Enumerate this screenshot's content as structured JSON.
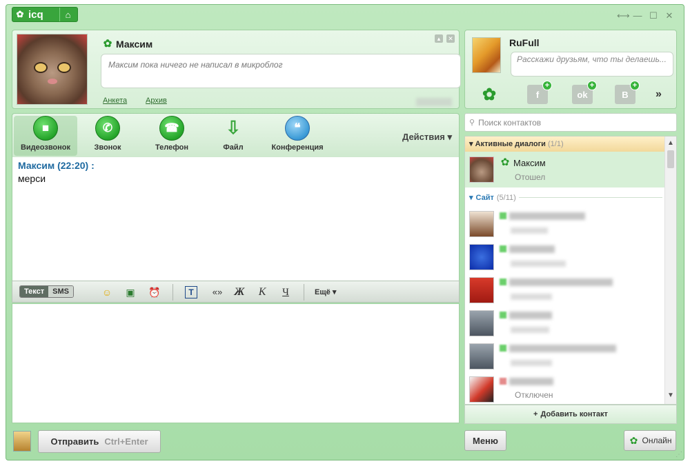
{
  "titlebar": {
    "logo_text": "icq",
    "logo_icon": "icq-flower-icon",
    "home_icon": "home-icon",
    "controls": [
      "⟷",
      "—",
      "☐",
      "✕"
    ]
  },
  "conversation": {
    "contact_name": "Максим",
    "microblog": "Максим пока ничего не написал в микроблог",
    "links": {
      "profile": "Анкета",
      "archive": "Архив"
    }
  },
  "toolbar": {
    "video": "Видеозвонок",
    "call": "Звонок",
    "phone": "Телефон",
    "file": "Файл",
    "conference": "Конференция",
    "actions": "Действия"
  },
  "chat": {
    "messages": [
      {
        "header": "Максим (22:20) :",
        "text": "мерси"
      }
    ]
  },
  "format_bar": {
    "mode_text": "Текст",
    "mode_sms": "SMS",
    "quote": "«»",
    "bold": "Ж",
    "italic": "К",
    "underline": "Ч",
    "more": "Ещё"
  },
  "send": {
    "label": "Отправить",
    "hotkey": "Ctrl+Enter"
  },
  "self": {
    "name": "RuFull",
    "status_placeholder": "Расскажи друзьям, что ты делаешь..."
  },
  "services": {
    "fb": "f",
    "ok": "ok",
    "vk": "B",
    "more": "»"
  },
  "search": {
    "placeholder": "Поиск контактов"
  },
  "contact_list": {
    "active_group": {
      "label": "Активные диалоги",
      "count": "(1/1)"
    },
    "active_contact": {
      "name": "Максим",
      "status": "Отошел"
    },
    "site_group": {
      "label": "Сайт",
      "count": "(5/11)"
    },
    "last_status": "Отключен"
  },
  "footer": {
    "add_contact": "Добавить контакт",
    "menu": "Меню",
    "status": "Онлайн"
  },
  "colors": {
    "window": "#bfe8bf",
    "accent_green": "#39a53c",
    "sender_blue": "#1f6aa0"
  }
}
